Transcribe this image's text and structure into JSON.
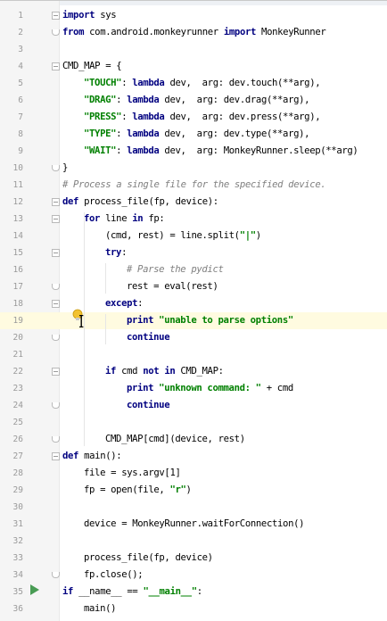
{
  "editor": {
    "lines": [
      {
        "n": "1",
        "indent": 0,
        "tokens": [
          [
            "kw",
            "import"
          ],
          [
            "n",
            " sys"
          ]
        ],
        "fold": "start"
      },
      {
        "n": "2",
        "indent": 0,
        "tokens": [
          [
            "kw",
            "from"
          ],
          [
            "n",
            " com.android.monkeyrunner "
          ],
          [
            "kw",
            "import"
          ],
          [
            "n",
            " MonkeyRunner"
          ]
        ],
        "fold": "end"
      },
      {
        "n": "3",
        "indent": 0,
        "tokens": []
      },
      {
        "n": "4",
        "indent": 0,
        "tokens": [
          [
            "n",
            "CMD_MAP = {"
          ]
        ],
        "fold": "start"
      },
      {
        "n": "5",
        "indent": 2,
        "tokens": [
          [
            "str",
            "\"TOUCH\""
          ],
          [
            "n",
            ": "
          ],
          [
            "kw",
            "lambda"
          ],
          [
            "n",
            " dev,  arg: dev.touch(**arg),"
          ]
        ]
      },
      {
        "n": "6",
        "indent": 2,
        "tokens": [
          [
            "str",
            "\"DRAG\""
          ],
          [
            "n",
            ": "
          ],
          [
            "kw",
            "lambda"
          ],
          [
            "n",
            " dev,  arg: dev.drag(**arg),"
          ]
        ]
      },
      {
        "n": "7",
        "indent": 2,
        "tokens": [
          [
            "str",
            "\"PRESS\""
          ],
          [
            "n",
            ": "
          ],
          [
            "kw",
            "lambda"
          ],
          [
            "n",
            " dev,  arg: dev.press(**arg),"
          ]
        ]
      },
      {
        "n": "8",
        "indent": 2,
        "tokens": [
          [
            "str",
            "\"TYPE\""
          ],
          [
            "n",
            ": "
          ],
          [
            "kw",
            "lambda"
          ],
          [
            "n",
            " dev,  arg: dev.type(**arg),"
          ]
        ]
      },
      {
        "n": "9",
        "indent": 2,
        "tokens": [
          [
            "str",
            "\"WAIT\""
          ],
          [
            "n",
            ": "
          ],
          [
            "kw",
            "lambda"
          ],
          [
            "n",
            " dev,  arg: MonkeyRunner.sleep(**arg)"
          ]
        ]
      },
      {
        "n": "10",
        "indent": 0,
        "tokens": [
          [
            "n",
            "}"
          ]
        ],
        "fold": "end"
      },
      {
        "n": "11",
        "indent": 0,
        "tokens": [
          [
            "cm",
            "# Process a single file for the specified device."
          ]
        ]
      },
      {
        "n": "12",
        "indent": 0,
        "tokens": [
          [
            "kw",
            "def"
          ],
          [
            "n",
            " process_file(fp, device):"
          ]
        ],
        "fold": "start"
      },
      {
        "n": "13",
        "indent": 2,
        "tokens": [
          [
            "kw",
            "for"
          ],
          [
            "n",
            " line "
          ],
          [
            "kw",
            "in"
          ],
          [
            "n",
            " fp:"
          ]
        ],
        "fold": "start"
      },
      {
        "n": "14",
        "indent": 4,
        "tokens": [
          [
            "n",
            "(cmd, rest) = line.split("
          ],
          [
            "str",
            "\"|\""
          ],
          [
            "n",
            ")"
          ]
        ]
      },
      {
        "n": "15",
        "indent": 4,
        "tokens": [
          [
            "kw",
            "try"
          ],
          [
            "n",
            ":"
          ]
        ],
        "fold": "start"
      },
      {
        "n": "16",
        "indent": 6,
        "tokens": [
          [
            "cm",
            "# Parse the pydict"
          ]
        ]
      },
      {
        "n": "17",
        "indent": 6,
        "tokens": [
          [
            "n",
            "rest = eval(rest)"
          ]
        ],
        "fold": "end"
      },
      {
        "n": "18",
        "indent": 4,
        "tokens": [
          [
            "kw",
            "except"
          ],
          [
            "n",
            ":"
          ]
        ],
        "fold": "start"
      },
      {
        "n": "19",
        "indent": 6,
        "tokens": [
          [
            "kw",
            "print"
          ],
          [
            "n",
            " "
          ],
          [
            "str",
            "\"unable to parse options\""
          ]
        ],
        "highlight": true
      },
      {
        "n": "20",
        "indent": 6,
        "tokens": [
          [
            "kw",
            "continue"
          ]
        ],
        "fold": "end"
      },
      {
        "n": "21",
        "indent": 0,
        "tokens": []
      },
      {
        "n": "22",
        "indent": 4,
        "tokens": [
          [
            "kw",
            "if"
          ],
          [
            "n",
            " cmd "
          ],
          [
            "kw",
            "not in"
          ],
          [
            "n",
            " CMD_MAP:"
          ]
        ],
        "fold": "start"
      },
      {
        "n": "23",
        "indent": 6,
        "tokens": [
          [
            "kw",
            "print"
          ],
          [
            "n",
            " "
          ],
          [
            "str",
            "\"unknown command: \""
          ],
          [
            "n",
            " + cmd"
          ]
        ]
      },
      {
        "n": "24",
        "indent": 6,
        "tokens": [
          [
            "kw",
            "continue"
          ]
        ],
        "fold": "end"
      },
      {
        "n": "25",
        "indent": 0,
        "tokens": []
      },
      {
        "n": "26",
        "indent": 4,
        "tokens": [
          [
            "n",
            "CMD_MAP[cmd](device, rest)"
          ]
        ],
        "fold": "end"
      },
      {
        "n": "27",
        "indent": 0,
        "tokens": [
          [
            "kw",
            "def"
          ],
          [
            "n",
            " main():"
          ]
        ],
        "fold": "start"
      },
      {
        "n": "28",
        "indent": 2,
        "tokens": [
          [
            "n",
            "file = sys.argv[1]"
          ]
        ]
      },
      {
        "n": "29",
        "indent": 2,
        "tokens": [
          [
            "n",
            "fp = open(file, "
          ],
          [
            "str",
            "\"r\""
          ],
          [
            "n",
            ")"
          ]
        ]
      },
      {
        "n": "30",
        "indent": 0,
        "tokens": []
      },
      {
        "n": "31",
        "indent": 2,
        "tokens": [
          [
            "n",
            "device = MonkeyRunner.waitForConnection()"
          ]
        ]
      },
      {
        "n": "32",
        "indent": 0,
        "tokens": []
      },
      {
        "n": "33",
        "indent": 2,
        "tokens": [
          [
            "n",
            "process_file(fp, device)"
          ]
        ]
      },
      {
        "n": "34",
        "indent": 2,
        "tokens": [
          [
            "n",
            "fp.close();"
          ]
        ],
        "fold": "end"
      },
      {
        "n": "35",
        "indent": 0,
        "tokens": [
          [
            "kw",
            "if"
          ],
          [
            "n",
            " __name__ == "
          ],
          [
            "str",
            "\"__main__\""
          ],
          [
            "n",
            ":"
          ]
        ],
        "run": true
      },
      {
        "n": "36",
        "indent": 2,
        "tokens": [
          [
            "n",
            "main()"
          ]
        ]
      }
    ],
    "colors": {
      "keyword": "#000080",
      "string": "#008000",
      "comment": "#808080",
      "highlight_line": "#fffbe0",
      "run_icon": "#499c54",
      "bulb": "#f2c230"
    },
    "icons": {
      "run": "run-triangle-icon",
      "intention": "lightbulb-icon"
    }
  }
}
